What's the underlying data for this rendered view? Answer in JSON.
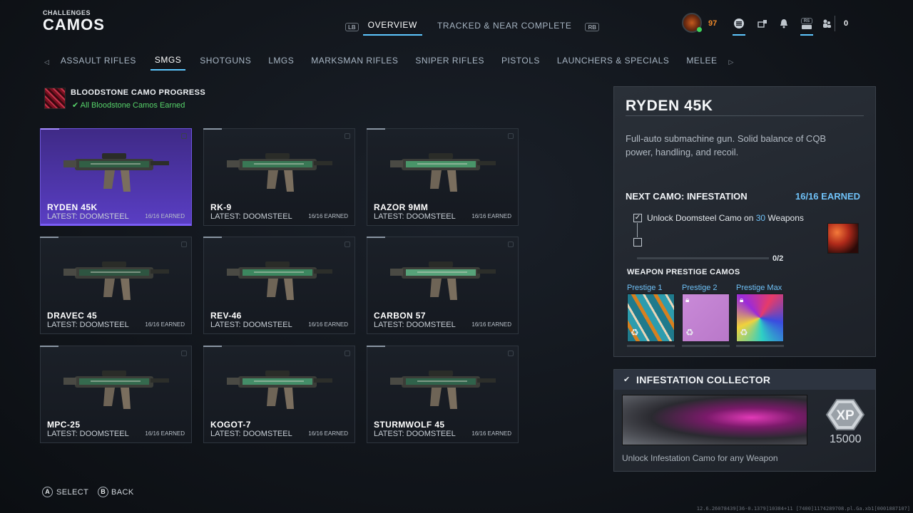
{
  "header": {
    "section": "CHALLENGES",
    "title": "CAMOS"
  },
  "top_tabs": {
    "lb": "LB",
    "rb": "RB",
    "items": [
      {
        "label": "OVERVIEW",
        "active": true
      },
      {
        "label": "TRACKED & NEAR COMPLETE",
        "active": false
      }
    ]
  },
  "player": {
    "level": "97",
    "count": "0",
    "rs": "RS"
  },
  "categories": {
    "items": [
      {
        "label": "ASSAULT RIFLES",
        "active": false
      },
      {
        "label": "SMGS",
        "active": true
      },
      {
        "label": "SHOTGUNS",
        "active": false
      },
      {
        "label": "LMGS",
        "active": false
      },
      {
        "label": "MARKSMAN RIFLES",
        "active": false
      },
      {
        "label": "SNIPER RIFLES",
        "active": false
      },
      {
        "label": "PISTOLS",
        "active": false
      },
      {
        "label": "LAUNCHERS & SPECIALS",
        "active": false
      },
      {
        "label": "MELEE",
        "active": false
      }
    ]
  },
  "bloodstone": {
    "title": "BLOODSTONE CAMO PROGRESS",
    "status": "All Bloodstone Camos Earned"
  },
  "weapons": [
    {
      "name": "RYDEN 45K",
      "latest": "LATEST: DOOMSTEEL",
      "earned": "16/16 EARNED",
      "selected": true
    },
    {
      "name": "RK-9",
      "latest": "LATEST: DOOMSTEEL",
      "earned": "16/16 EARNED"
    },
    {
      "name": "RAZOR 9MM",
      "latest": "LATEST: DOOMSTEEL",
      "earned": "16/16 EARNED"
    },
    {
      "name": "DRAVEC 45",
      "latest": "LATEST: DOOMSTEEL",
      "earned": "16/16 EARNED"
    },
    {
      "name": "REV-46",
      "latest": "LATEST: DOOMSTEEL",
      "earned": "16/16 EARNED"
    },
    {
      "name": "CARBON 57",
      "latest": "LATEST: DOOMSTEEL",
      "earned": "16/16 EARNED"
    },
    {
      "name": "MPC-25",
      "latest": "LATEST: DOOMSTEEL",
      "earned": "16/16 EARNED"
    },
    {
      "name": "KOGOT-7",
      "latest": "LATEST: DOOMSTEEL",
      "earned": "16/16 EARNED"
    },
    {
      "name": "STURMWOLF 45",
      "latest": "LATEST: DOOMSTEEL",
      "earned": "16/16 EARNED"
    }
  ],
  "detail": {
    "title": "RYDEN 45K",
    "description": "Full-auto submachine gun. Solid balance of CQB power, handling, and recoil.",
    "next_camo": "NEXT CAMO: INFESTATION",
    "next_earned": "16/16 EARNED",
    "challenge_prefix": "Unlock Doomsteel Camo on ",
    "challenge_count": "30",
    "challenge_suffix": " Weapons",
    "progress_text": "0/2",
    "progress_fraction": 0,
    "prestige_heading": "WEAPON PRESTIGE CAMOS",
    "prestige": [
      {
        "label": "Prestige 1",
        "locked": false
      },
      {
        "label": "Prestige 2",
        "locked": true
      },
      {
        "label": "Prestige Max",
        "locked": true
      }
    ]
  },
  "collector": {
    "title": "INFESTATION COLLECTOR",
    "xp_label": "XP",
    "xp_amount": "15000",
    "description": "Unlock Infestation Camo for any Weapon"
  },
  "footer": {
    "select_key": "A",
    "select_label": "SELECT",
    "back_key": "B",
    "back_label": "BACK",
    "build": "12.6.26078439[36-0.1379]10384+11 [7400]1174289708.pl.Ga.xb1[0001887107]"
  },
  "colors": {
    "accent": "#5ec7ff",
    "selected_card": "#4d35a8",
    "success": "#57d36a",
    "level": "#f08a2a",
    "earned": "#6fc1f7"
  }
}
